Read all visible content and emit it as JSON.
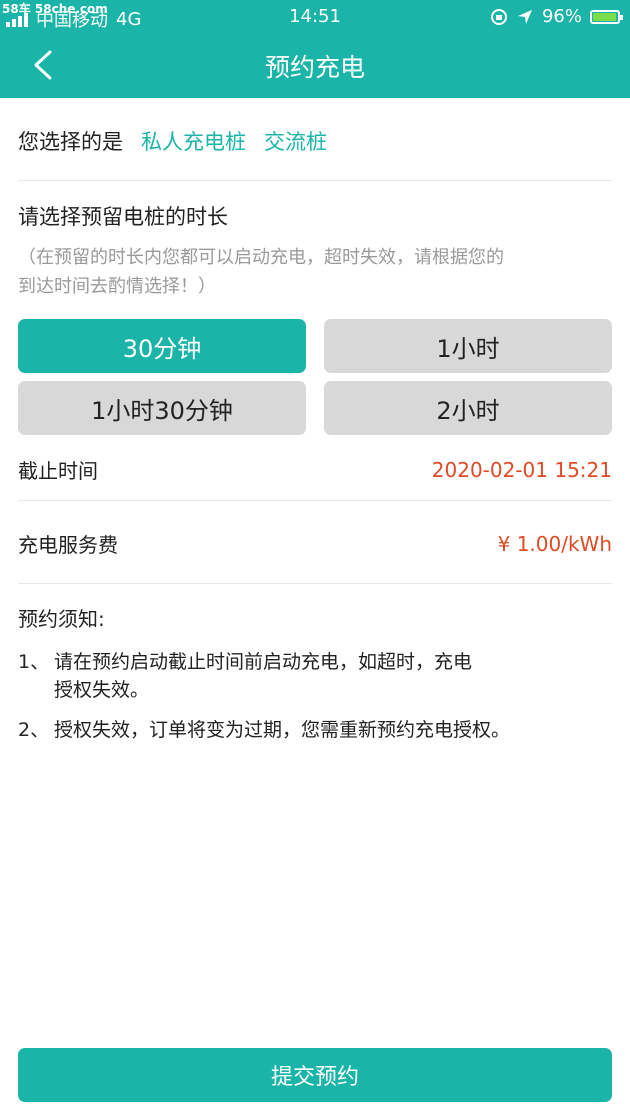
{
  "status_bar": {
    "watermark": "58车 58che.com",
    "carrier": "中国移动",
    "network": "4G",
    "time": "14:51",
    "battery_percent": "96%",
    "battery_level": 0.96,
    "icons": [
      "signal-icon",
      "lock-rotation-icon",
      "location-arrow-icon",
      "battery-icon"
    ]
  },
  "nav": {
    "title": "预约充电",
    "back_icon": "chevron-left-icon"
  },
  "selection": {
    "label": "您选择的是",
    "type": "私人充电桩",
    "kind": "交流桩"
  },
  "duration": {
    "title": "请选择预留电桩的时长",
    "hint_line1": "（在预留的时长内您都可以启动充电，超时失效，请根据您的",
    "hint_line2": "到达时间去酌情选择！）",
    "options": [
      {
        "label": "30分钟",
        "selected": true
      },
      {
        "label": "1小时",
        "selected": false
      },
      {
        "label": "1小时30分钟",
        "selected": false
      },
      {
        "label": "2小时",
        "selected": false
      }
    ]
  },
  "deadline": {
    "label": "截止时间",
    "value": "2020-02-01 15:21"
  },
  "fee": {
    "label": "充电服务费",
    "value": "¥ 1.00/kWh"
  },
  "notes": {
    "title": "预约须知:",
    "items": [
      {
        "num": "1、",
        "line1": "请在预约启动截止时间前启动充电，如超时，充电",
        "line2": "授权失效。"
      },
      {
        "num": "2、",
        "line1": "授权失效，订单将变为过期，您需重新预约充电授权。",
        "line2": ""
      }
    ]
  },
  "submit_label": "提交预约",
  "colors": {
    "accent": "#1ab5a8",
    "price": "#e04a24",
    "option_inactive": "#d8d8d8"
  }
}
